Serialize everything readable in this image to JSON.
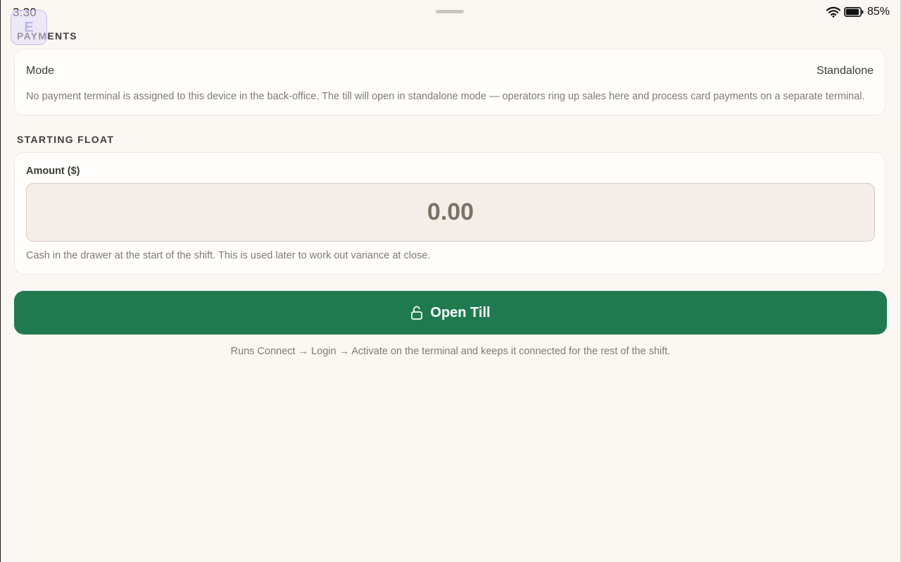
{
  "status_bar": {
    "time": "3:30",
    "battery_percent": "85%",
    "icons": [
      "wifi-icon",
      "battery-icon"
    ]
  },
  "app_badge": {
    "letter": "E"
  },
  "payments": {
    "section_title": "PAYMENTS",
    "mode_label": "Mode",
    "mode_value": "Standalone",
    "help_text": "No payment terminal is assigned to this device in the back-office. The till will open in standalone mode — operators ring up sales here and process card payments on a separate terminal."
  },
  "starting_float": {
    "section_title": "STARTING FLOAT",
    "amount_label": "Amount ($)",
    "amount_value": "0.00",
    "help_text": "Cash in the drawer at the start of the shift. This is used later to work out variance at close."
  },
  "actions": {
    "open_till_label": "Open Till",
    "open_till_icon": "unlock-icon",
    "footer_note": "Runs Connect → Login → Activate on the terminal and keeps it connected for the rest of the shift."
  },
  "colors": {
    "background": "#fbf8f3",
    "primary_button": "#1f7b4f",
    "input_background": "#f5ede7",
    "muted_text": "#7f7a71"
  }
}
